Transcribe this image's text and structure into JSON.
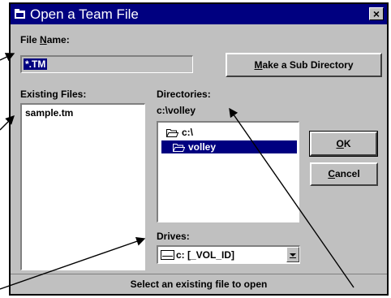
{
  "window": {
    "title": "Open a Team File",
    "close_glyph": "×",
    "icon": "folder-window-icon"
  },
  "file_name": {
    "label_pre": "File ",
    "label_key": "N",
    "label_post": "ame:",
    "value": "*.TM"
  },
  "sub_dir_button": {
    "label_key": "M",
    "label_post": "ake a Sub Directory"
  },
  "existing_files": {
    "label": "Existing Files:",
    "items": [
      "sample.tm"
    ]
  },
  "directories": {
    "label": "Directories:",
    "current_path": "c:\\volley",
    "items": [
      {
        "name": "c:\\",
        "icon": "open-folder-icon",
        "selected": false
      },
      {
        "name": "volley",
        "icon": "open-folder-icon",
        "selected": true
      }
    ]
  },
  "ok_button": {
    "label_key": "O",
    "label_post": "K"
  },
  "cancel_button": {
    "label_key": "C",
    "label_post": "ancel"
  },
  "drives": {
    "label": "Drives:",
    "value": "c: [_VOL_ID]",
    "icon": "drive-icon"
  },
  "status_bar": {
    "text": "Select an existing file to open"
  },
  "colors": {
    "title_bar": "#000080",
    "dialog_bg": "#c0c0c0",
    "selection": "#000080"
  }
}
